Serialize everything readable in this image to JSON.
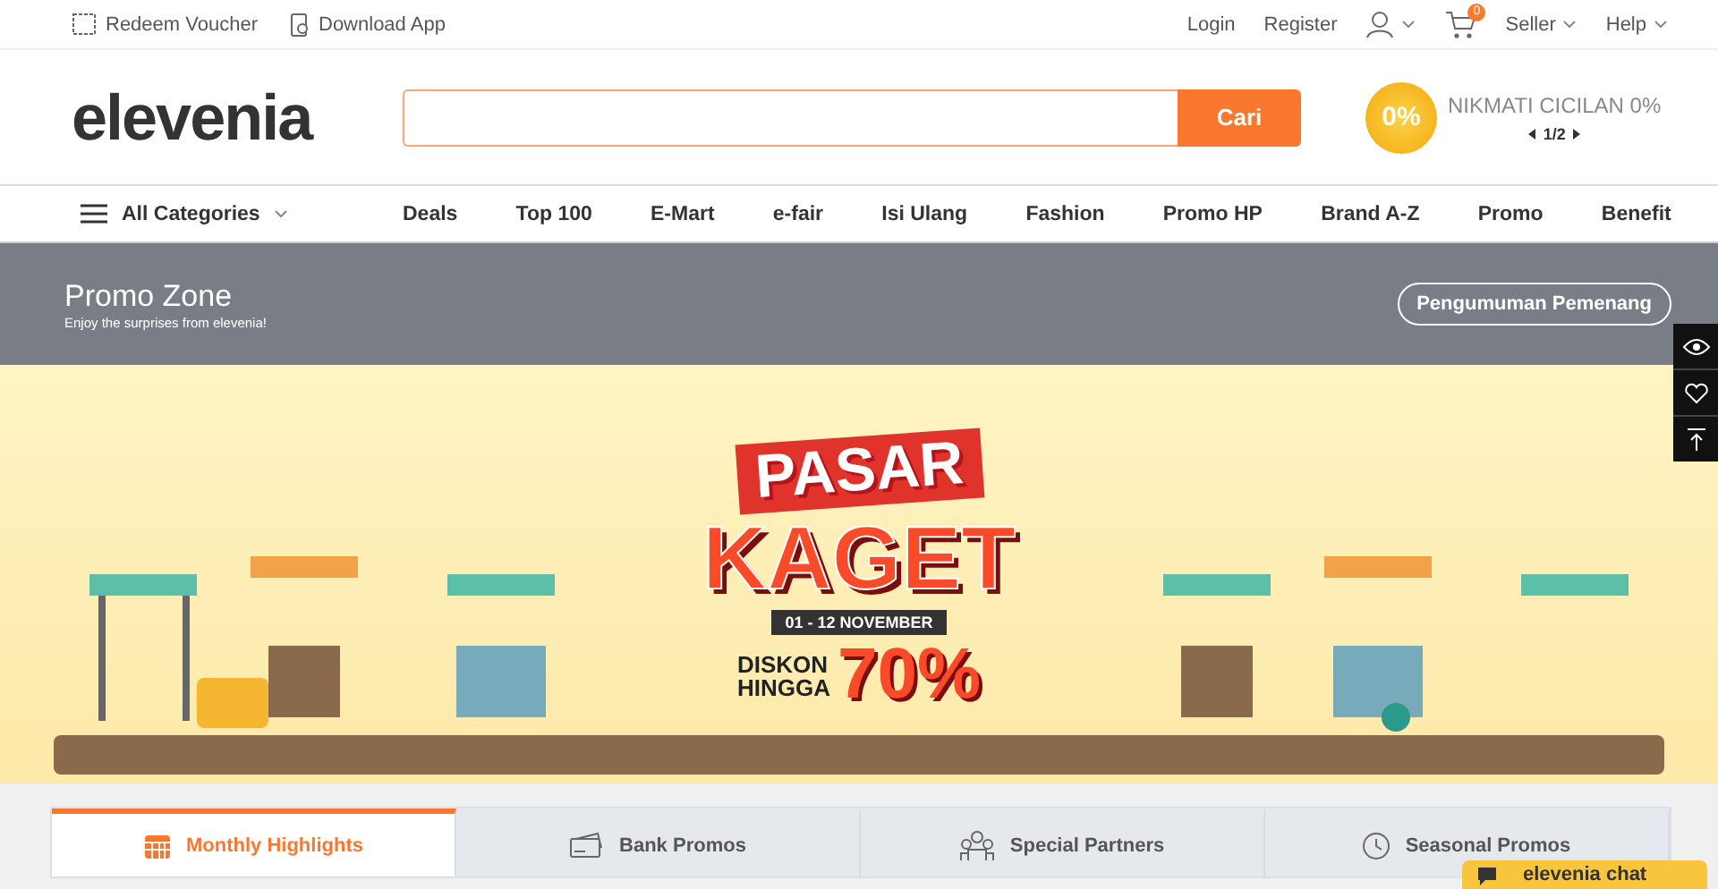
{
  "top_bar": {
    "left_links": [
      {
        "label": "Redeem Voucher",
        "kind": "voucher"
      },
      {
        "label": "Download App",
        "kind": "app"
      }
    ],
    "right_links": [
      {
        "label": "Login"
      },
      {
        "label": "Register"
      }
    ],
    "cart_count": "0",
    "menus": [
      {
        "label": "Seller"
      },
      {
        "label": "Help"
      }
    ]
  },
  "header": {
    "logo": "elevenia",
    "search": {
      "button": "Cari"
    },
    "promo": {
      "badge": "0%",
      "text": "NIKMATI CICILAN 0%",
      "pager": "1/2"
    }
  },
  "nav": {
    "categories": "All Categories",
    "items": [
      "Deals",
      "Top 100",
      "E-Mart",
      "e-fair",
      "Isi Ulang",
      "Fashion",
      "Promo HP",
      "Brand A-Z",
      "Promo",
      "Benefit"
    ]
  },
  "promo_zone": {
    "title": "Promo Zone",
    "subtitle": "Enjoy the surprises from elevenia!",
    "button": "Pengumuman Pemenang"
  },
  "banner": {
    "title_1": "PASAR",
    "title_2": "KAGET",
    "dates": "01 - 12 NOVEMBER",
    "discount_label_1": "DISKON",
    "discount_label_2": "HINGGA",
    "discount": "70%"
  },
  "tabs": [
    {
      "label": "Monthly Highlights",
      "kind": "calendar",
      "selected": true
    },
    {
      "label": "Bank Promos",
      "kind": "card",
      "selected": false
    },
    {
      "label": "Special Partners",
      "kind": "people",
      "selected": false
    },
    {
      "label": "Seasonal Promos",
      "kind": "clock",
      "selected": false
    }
  ],
  "chat": {
    "label": "elevenia chat"
  }
}
